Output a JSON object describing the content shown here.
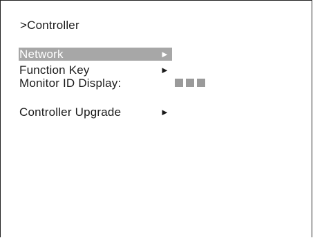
{
  "screen": {
    "title": ">Controller"
  },
  "menu": {
    "items": [
      {
        "label": "Network",
        "arrow": "►",
        "selected": true
      },
      {
        "label": "Function Key",
        "arrow": "►",
        "selected": false
      },
      {
        "label": "Monitor ID Display:",
        "value_indicator": "■■■",
        "selected": false
      },
      {
        "label": "Controller Upgrade",
        "arrow": "►",
        "selected": false
      }
    ]
  },
  "colors": {
    "selection_bg": "#a7a7a7",
    "text": "#1a1a1a",
    "indicator": "#9a9a9a"
  },
  "icons": {
    "submenu": "right-triangle-icon",
    "monitor_id_blocks": "square-blocks-icon"
  }
}
